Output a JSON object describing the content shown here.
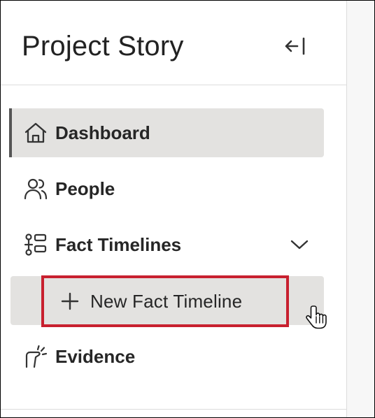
{
  "header": {
    "title": "Project Story",
    "collapse_icon": "collapse-left-icon"
  },
  "nav": {
    "items": [
      {
        "label": "Dashboard",
        "icon": "home-icon",
        "active": true
      },
      {
        "label": "People",
        "icon": "people-icon",
        "active": false
      },
      {
        "label": "Fact Timelines",
        "icon": "timeline-icon",
        "active": false,
        "expanded": true
      },
      {
        "label": "Evidence",
        "icon": "evidence-icon",
        "active": false
      }
    ],
    "sub_items": [
      {
        "label": "New Fact Timeline",
        "icon": "plus-icon",
        "highlighted": true
      }
    ]
  },
  "colors": {
    "active_bg": "#e3e2e0",
    "highlight_border": "#c8202f",
    "active_indicator": "#555555"
  }
}
